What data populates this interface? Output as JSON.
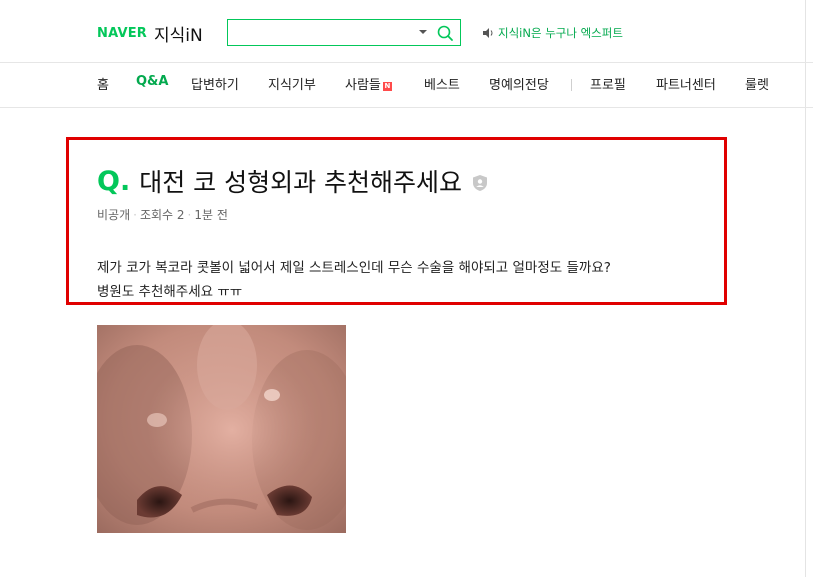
{
  "header": {
    "brand": "NAVER",
    "service": "지식iN",
    "search": {
      "value": "",
      "placeholder": ""
    },
    "notice": "지식iN은 누구나 엑스퍼트"
  },
  "nav": {
    "items": [
      {
        "label": "홈"
      },
      {
        "label": "Q&A",
        "active": true
      },
      {
        "label": "답변하기"
      },
      {
        "label": "지식기부"
      },
      {
        "label": "사람들",
        "badge": "N"
      },
      {
        "label": "베스트"
      },
      {
        "label": "명예의전당"
      },
      {
        "label": "프로필"
      },
      {
        "label": "파트너센터"
      },
      {
        "label": "룰렛"
      }
    ]
  },
  "question": {
    "mark": "Q.",
    "title": "대전 코 성형외과 추천해주세요",
    "meta": {
      "visibility": "비공개",
      "views": "조회수 2",
      "time": "1분 전"
    },
    "body": [
      "제가 코가 복코라 콧볼이 넓어서 제일 스트레스인데 무슨 수술을 해야되고 얼마정도 들까요?",
      "병원도 추천해주세요 ㅠㅠ"
    ]
  },
  "colors": {
    "accent": "#03c75a",
    "highlight": "#e00000"
  },
  "icons": [
    "search-icon",
    "dropdown-arrow-icon",
    "speaker-icon",
    "shield-icon"
  ]
}
